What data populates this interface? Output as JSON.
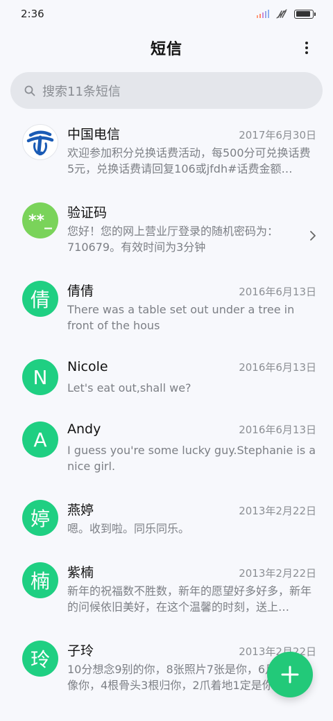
{
  "status_bar": {
    "time": "2:36",
    "battery_level": 0.9
  },
  "header": {
    "title": "短信"
  },
  "search": {
    "placeholder": "搜索11条短信"
  },
  "colors": {
    "avatar_green": "#1fcf82",
    "verify_green": "#7ad35a",
    "fab_green": "#22c979",
    "telecom_blue": "#1a5bb5"
  },
  "messages": [
    {
      "name": "中国电信",
      "date": "2017年6月30日",
      "preview": "欢迎参加积分兑换话费活动，每500分可兑换话费5元，兑换话费请回复106或jfdh#话费金额…",
      "avatar_icon": "china-telecom-logo-icon"
    },
    {
      "name": "验证码",
      "date": "",
      "preview": "您好！您的网上营业厅登录的随机密码为：710679。有效时间为3分钟",
      "avatar_text": "**_"
    },
    {
      "name": "倩倩",
      "date": "2016年6月13日",
      "preview": "There was a table set out under a tree in front of the hous",
      "avatar_text": "倩"
    },
    {
      "name": "Nicole",
      "date": "2016年6月13日",
      "preview": "Let's eat out,shall we?",
      "avatar_text": "N"
    },
    {
      "name": "Andy",
      "date": "2016年6月13日",
      "preview": "I guess you're some lucky guy.Stephanie is a nice girl.",
      "avatar_text": "A"
    },
    {
      "name": "燕婷",
      "date": "2013年2月22日",
      "preview": "嗯。收到啦。同乐同乐。",
      "avatar_text": "婷"
    },
    {
      "name": "紫楠",
      "date": "2013年2月22日",
      "preview": "新年的祝福数不胜数，新年的愿望好多好多，新年的问候依旧美好，在这个温馨的时刻，送上…",
      "avatar_text": "楠"
    },
    {
      "name": "子玲",
      "date": "2013年2月22日",
      "preview": "10分想念9别的你，8张照片7张是你，6月里，只像你，4根骨头3根归你，2爪着地1定是你，…",
      "avatar_text": "玲"
    }
  ],
  "fab": {
    "icon": "plus-icon"
  }
}
